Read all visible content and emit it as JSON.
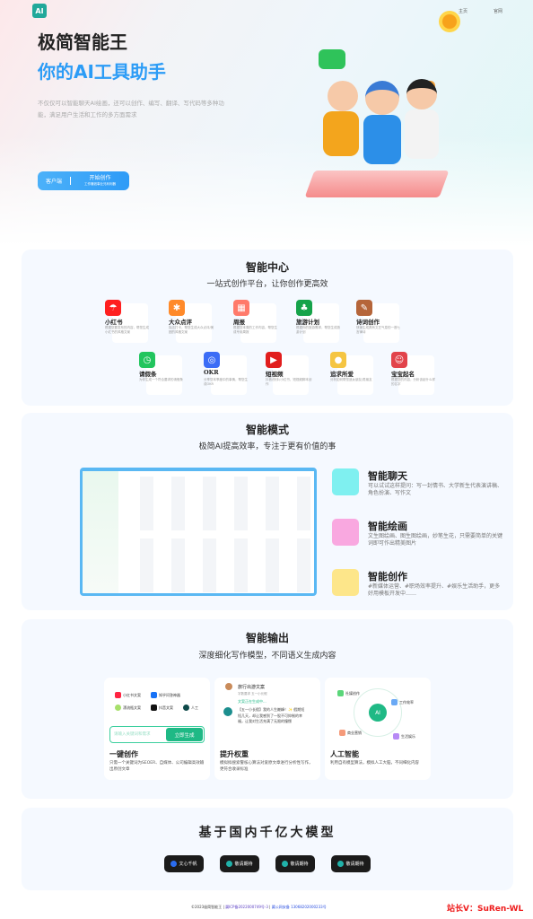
{
  "header": {
    "logo_text": "AI",
    "nav": [
      "主页",
      "官网"
    ]
  },
  "hero": {
    "title": "极简智能王",
    "subtitle": "你的AI工具助手",
    "description": "不仅仅可以智能聊天AI绘画，还可以创作、编写、翻译、写代码等多种功能，满足用户生活和工作的多方面需求",
    "client_label": "客户端",
    "start_label": "开始创作",
    "start_sub": "工作赚钱事业兄利利器"
  },
  "center": {
    "title": "智能中心",
    "subtitle": "一站式创作平台，让你创作更高效",
    "tools": [
      {
        "name": "小红书",
        "desc": "根据您要发布的内容，帮您生成小红书的风格文案",
        "color": "#ff2020",
        "icon": "umbrella-icon"
      },
      {
        "name": "大众点评",
        "desc": "探店打卡，帮您生成大众点评/美团的风格文案",
        "color": "#ff8a2a",
        "icon": "person-icon"
      },
      {
        "name": "周报",
        "desc": "根据您本周的工作内容，帮您生成专用周报",
        "color": "#ff7a6a",
        "icon": "calendar-icon"
      },
      {
        "name": "旅游计划",
        "desc": "根据你的旅游需求，帮您生成旅游计划",
        "color": "#16a34a",
        "icon": "palm-icon"
      },
      {
        "name": "诗词创作",
        "desc": "快速生成具有文艺气息的一首七言律诗",
        "color": "#b5653a",
        "icon": "book-icon"
      },
      {
        "name": "请假条",
        "desc": "为你生成一个符合要求的请假条",
        "color": "#22c55e",
        "icon": "clock-icon"
      },
      {
        "name": "OKR",
        "desc": "分享您本季度中的事情，帮您生成OKR",
        "color": "#3b6cf6",
        "icon": "target-icon"
      },
      {
        "name": "短视频",
        "desc": "抖音/快手/小红书，短视频脚本创作",
        "color": "#e11d1d",
        "icon": "play-icon"
      },
      {
        "name": "追求所爱",
        "desc": "分析如何帮您追女朋友/男朋友",
        "color": "#f5c542",
        "icon": "dog-icon"
      },
      {
        "name": "宝宝起名",
        "desc": "根据您的内容，分析该起什么样的名字",
        "color": "#e2434b",
        "icon": "baby-icon"
      }
    ]
  },
  "mode": {
    "title": "智能模式",
    "subtitle": "极简AI提高效率，专注于更有价值的事",
    "features": [
      {
        "title": "智能聊天",
        "desc": "可以试试这样提问：写一封情书、大学新生代表演讲稿、角色扮演、写作文",
        "color": "#7ff0f0"
      },
      {
        "title": "智能绘画",
        "desc": "文生图绘画、图生图绘画，妙笔生花，只需要简单的关键词即可作出精美图片",
        "color": "#f9a8e0"
      },
      {
        "title": "智能创作",
        "desc": "#新媒体运营、#职场效率提升、#娱乐生活助手，更多好用模板开发中……",
        "color": "#fde68a"
      }
    ]
  },
  "output": {
    "title": "智能输出",
    "subtitle": "深度细化写作模型，不同语义生成内容",
    "chips": [
      "小红书文案",
      "知乎问答神器",
      "漂流瓶文案",
      "抖音文案",
      "人工"
    ],
    "input_placeholder": "请输入关键词和需求",
    "generate_label": "立即生成",
    "chat_title": "旅行出游文案",
    "chat_tags": "字数要求   五一小长假",
    "chat_status": "文案正在生成中...",
    "chat_text": "【五一小长假】我的人生巅峰！✨ 假期短短几天，却让我感到了一股不可抑制的幸福，让我对生活充满了无限的憧憬",
    "ai_center": "AI",
    "ai_nodes": [
      "社媒创作",
      "工作效率",
      "商业营销",
      "生活娱乐"
    ],
    "cards": [
      {
        "title": "一键创作",
        "desc": "只需一个关键词为SEOER、自媒体、公司编辑高效输出原创文章"
      },
      {
        "title": "提升权重",
        "desc": "模拟拟搜索警核心算法对爱原文章进行分析性写作，更符合收录标准"
      },
      {
        "title": "人工智能",
        "desc": "利用自有模型算法，模拟人工大脑，不同细化内容"
      }
    ]
  },
  "models": {
    "title": "基于国内千亿大模型",
    "items": [
      "文心千帆",
      "敬请期待",
      "敬请期待",
      "敬请期待"
    ]
  },
  "footer": {
    "copyright": "©2023极简智能王",
    "icp": "冀ICP备2022000749号-3",
    "police": "冀公网安备 13068202000233号",
    "watermark": "站长V：SuRen-WL"
  }
}
